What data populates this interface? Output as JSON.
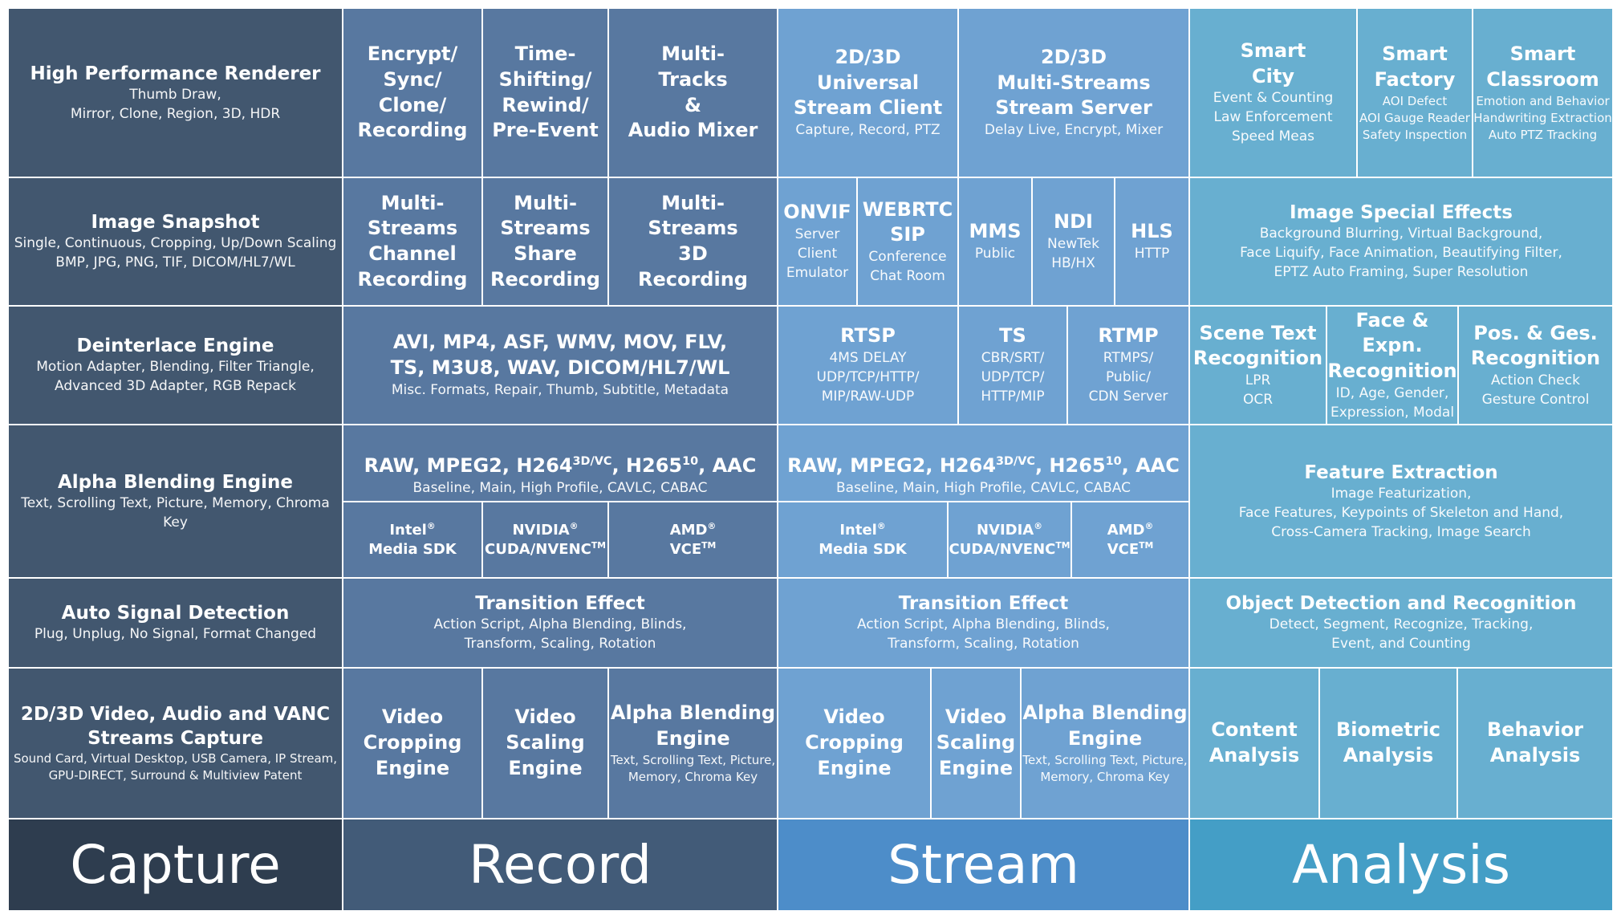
{
  "banners": {
    "capture": "Capture",
    "record": "Record",
    "stream": "Stream",
    "analysis": "Analysis"
  },
  "colors": {
    "capture": "#42576f",
    "record": "#5878a0",
    "stream": "#6fa2d2",
    "analysis": "#68afd0",
    "banner_capture": "#2e3d4f",
    "banner_record": "#425b78",
    "banner_stream": "#4d8dc9",
    "banner_analysis": "#449ec6"
  },
  "capture": [
    {
      "title": "High Performance Renderer",
      "sub": "Thumb Draw,\nMirror, Clone, Region, 3D, HDR"
    },
    {
      "title": "Image Snapshot",
      "sub": "Single, Continuous, Cropping, Up/Down Scaling\nBMP, JPG, PNG, TIF, DICOM/HL7/WL"
    },
    {
      "title": "Deinterlace Engine",
      "sub": "Motion Adapter, Blending, Filter Triangle,\nAdvanced 3D Adapter, RGB Repack"
    },
    {
      "title": "Alpha Blending Engine",
      "sub": "Text, Scrolling Text, Picture, Memory, Chroma Key"
    },
    {
      "title": "Auto Signal Detection",
      "sub": "Plug, Unplug, No Signal, Format Changed"
    },
    {
      "title": "2D/3D Video, Audio and VANC\nStreams Capture",
      "sub": "Sound Card, Virtual Desktop, USB Camera, IP Stream,\nGPU-DIRECT, Surround & Multiview Patent"
    }
  ],
  "record": {
    "row1": [
      {
        "title": "Encrypt/\nSync/\nClone/\nRecording"
      },
      {
        "title": "Time-\nShifting/\nRewind/\nPre-Event"
      },
      {
        "title": "Multi-\nTracks\n&\nAudio Mixer"
      }
    ],
    "row2": [
      {
        "title": "Multi-\nStreams\nChannel\nRecording"
      },
      {
        "title": "Multi-\nStreams\nShare\nRecording"
      },
      {
        "title": "Multi-\nStreams\n3D\nRecording"
      }
    ],
    "formats": {
      "title": "AVI, MP4, ASF, WMV, MOV, FLV,\nTS, M3U8, WAV, DICOM/HL7/WL",
      "sub": "Misc. Formats, Repair, Thumb, Subtitle, Metadata"
    },
    "codecs": {
      "pre": "RAW, MPEG2, H264",
      "sup1": "3D/VC",
      "mid": ", H265",
      "sup2": "10",
      "post": ", AAC",
      "sub": "Baseline, Main, High Profile, CAVLC, CABAC"
    },
    "hardware": [
      {
        "brand": "Intel",
        "mark": "®",
        "name": "Media SDK",
        "name_mark": ""
      },
      {
        "brand": "NVIDIA",
        "mark": "®",
        "name": "CUDA/NVENC",
        "name_mark": "TM"
      },
      {
        "brand": "AMD",
        "mark": "®",
        "name": "VCE",
        "name_mark": "TM"
      }
    ],
    "transition": {
      "title": "Transition Effect",
      "sub": "Action Script, Alpha Blending, Blinds,\nTransform, Scaling, Rotation"
    },
    "row6": [
      {
        "title": "Video\nCropping\nEngine",
        "sub": ""
      },
      {
        "title": "Video\nScaling\nEngine",
        "sub": ""
      },
      {
        "title": "Alpha Blending\nEngine",
        "sub": "Text, Scrolling Text, Picture,\nMemory, Chroma Key"
      }
    ]
  },
  "stream": {
    "row1": [
      {
        "title": "2D/3D\nUniversal\nStream Client",
        "sub": "Capture, Record, PTZ"
      },
      {
        "title": "2D/3D\nMulti-Streams\nStream Server",
        "sub": "Delay Live, Encrypt, Mixer"
      }
    ],
    "row2": [
      {
        "title": "ONVIF",
        "sub": "Server\nClient\nEmulator"
      },
      {
        "title": "WEBRTC\nSIP",
        "sub": "Conference\nChat Room"
      },
      {
        "title": "MMS",
        "sub": "Public"
      },
      {
        "title": "NDI",
        "sub": "NewTek\nHB/HX"
      },
      {
        "title": "HLS",
        "sub": "HTTP"
      }
    ],
    "row3": [
      {
        "title": "RTSP",
        "sub": "4MS DELAY\nUDP/TCP/HTTP/\nMIP/RAW-UDP"
      },
      {
        "title": "TS",
        "sub": "CBR/SRT/\nUDP/TCP/\nHTTP/MIP"
      },
      {
        "title": "RTMP",
        "sub": "RTMPS/\nPublic/\nCDN Server"
      }
    ],
    "codecs": {
      "pre": "RAW, MPEG2, H264",
      "sup1": "3D/VC",
      "mid": ", H265",
      "sup2": "10",
      "post": ", AAC",
      "sub": "Baseline, Main, High Profile, CAVLC, CABAC"
    },
    "hardware": [
      {
        "brand": "Intel",
        "mark": "®",
        "name": "Media SDK",
        "name_mark": ""
      },
      {
        "brand": "NVIDIA",
        "mark": "®",
        "name": "CUDA/NVENC",
        "name_mark": "TM"
      },
      {
        "brand": "AMD",
        "mark": "®",
        "name": "VCE",
        "name_mark": "TM"
      }
    ],
    "transition": {
      "title": "Transition Effect",
      "sub": "Action Script, Alpha Blending, Blinds,\nTransform, Scaling, Rotation"
    },
    "row6": [
      {
        "title": "Video\nCropping\nEngine",
        "sub": ""
      },
      {
        "title": "Video\nScaling\nEngine",
        "sub": ""
      },
      {
        "title": "Alpha Blending\nEngine",
        "sub": "Text, Scrolling Text, Picture,\nMemory, Chroma Key"
      }
    ]
  },
  "analysis": {
    "row1": [
      {
        "title": "Smart\nCity",
        "sub": "Event & Counting\nLaw Enforcement\nSpeed Meas"
      },
      {
        "title": "Smart\nFactory",
        "sub": "AOI Defect\nAOI Gauge Reader\nSafety Inspection"
      },
      {
        "title": "Smart\nClassroom",
        "sub": "Emotion and Behavior\nHandwriting Extraction\nAuto PTZ Tracking"
      }
    ],
    "effects": {
      "title": "Image Special Effects",
      "sub": "Background Blurring, Virtual Background,\nFace Liquify, Face Animation, Beautifying Filter,\nEPTZ Auto Framing, Super Resolution"
    },
    "row3": [
      {
        "title": "Scene Text\nRecognition",
        "sub": "LPR\nOCR"
      },
      {
        "title": "Face & Expn.\nRecognition",
        "sub": "ID, Age, Gender,\nExpression, Modal"
      },
      {
        "title": "Pos. & Ges.\nRecognition",
        "sub": "Action Check\nGesture Control"
      }
    ],
    "features": {
      "title": "Feature Extraction",
      "sub": "Image Featurization,\nFace Features, Keypoints of Skeleton and Hand,\nCross-Camera Tracking, Image Search"
    },
    "objects": {
      "title": "Object Detection and Recognition",
      "sub": "Detect, Segment, Recognize, Tracking,\nEvent, and Counting"
    },
    "row6": [
      {
        "title": "Content\nAnalysis"
      },
      {
        "title": "Biometric\nAnalysis"
      },
      {
        "title": "Behavior\nAnalysis"
      }
    ]
  }
}
